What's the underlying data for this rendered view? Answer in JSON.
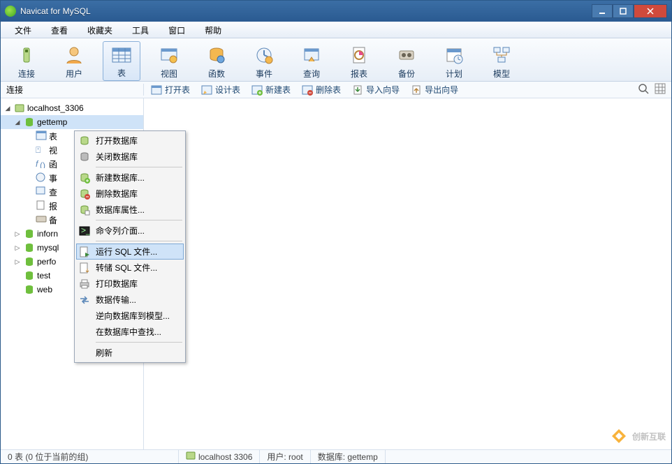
{
  "title": "Navicat for MySQL",
  "menu": [
    "文件",
    "查看",
    "收藏夹",
    "工具",
    "窗口",
    "帮助"
  ],
  "toolbar": [
    {
      "label": "连接"
    },
    {
      "label": "用户"
    },
    {
      "label": "表",
      "active": true
    },
    {
      "label": "视图"
    },
    {
      "label": "函数"
    },
    {
      "label": "事件"
    },
    {
      "label": "查询"
    },
    {
      "label": "报表"
    },
    {
      "label": "备份"
    },
    {
      "label": "计划"
    },
    {
      "label": "模型"
    }
  ],
  "subbar": {
    "connLabel": "连接",
    "actions": [
      "打开表",
      "设计表",
      "新建表",
      "删除表",
      "导入向导",
      "导出向导"
    ]
  },
  "tree": {
    "root": "localhost_3306",
    "selected": "gettemp",
    "children": [
      "表",
      "视",
      "函",
      "事",
      "查",
      "报",
      "备"
    ],
    "siblings": [
      "inforn",
      "mysql",
      "perfo",
      "test",
      "web"
    ]
  },
  "context": [
    {
      "label": "打开数据库",
      "icon": "db-open"
    },
    {
      "label": "关闭数据库",
      "icon": "db-close"
    },
    {
      "sep": true
    },
    {
      "label": "新建数据库...",
      "icon": "db-new"
    },
    {
      "label": "删除数据库",
      "icon": "db-del"
    },
    {
      "label": "数据库属性...",
      "icon": "db-prop"
    },
    {
      "sep": true
    },
    {
      "label": "命令列介面...",
      "icon": "cmd"
    },
    {
      "sep": true
    },
    {
      "label": "运行 SQL 文件...",
      "icon": "sql-run",
      "hover": true
    },
    {
      "label": "转储 SQL 文件...",
      "icon": "sql-dump"
    },
    {
      "label": "打印数据库",
      "icon": "print"
    },
    {
      "label": "数据传输...",
      "icon": "transfer"
    },
    {
      "label": "逆向数据库到模型...",
      "icon": ""
    },
    {
      "label": "在数据库中查找...",
      "icon": ""
    },
    {
      "sep": true
    },
    {
      "label": "刷新",
      "icon": ""
    }
  ],
  "status": {
    "left": "0 表 (0 位于当前的组)",
    "host": "localhost 3306",
    "user": "用户: root",
    "db": "数据库: gettemp"
  },
  "watermark": "创新互联"
}
